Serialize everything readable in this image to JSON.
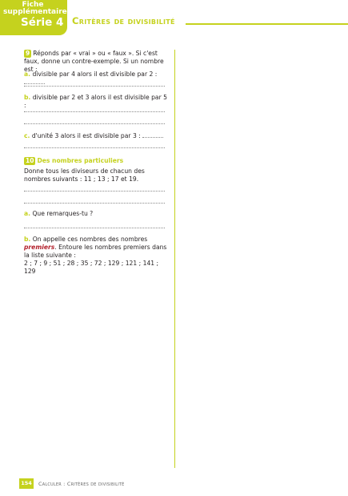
{
  "header": {
    "tab_line1": "Fiche",
    "tab_line2": "supplémentaire",
    "tab_line3": "Série 4",
    "title": "Critères de divisibilité",
    "accent_color": "#c5d21e"
  },
  "exercise9": {
    "number": "9",
    "intro": "Réponds par « vrai » ou « faux ». Si c'est faux, donne un contre-exemple. Si un nombre est :",
    "items": [
      {
        "label": "a.",
        "text": "divisible par 4 alors il est divisible par 2 :"
      },
      {
        "label": "b.",
        "text": "divisible par 2 et 3 alors il est divisible par 5 :"
      },
      {
        "label": "c.",
        "text": "d'unité 3 alors il est divisible par 3 :"
      }
    ]
  },
  "exercise10": {
    "number": "10",
    "title": "Des nombres particuliers",
    "intro": "Donne tous les diviseurs de chacun des nombres suivants : 11 ; 13 ; 17 et 19.",
    "a_label": "a.",
    "a_text": "Que remarques-tu ?",
    "b_label": "b.",
    "b_text_before": "On appelle ces nombres des nombres",
    "b_keyword": "premiers",
    "b_text_after": ". Entoure les nombres premiers dans la liste suivante :",
    "list": "2 ; 7 ; 9 ; 51 ; 28 ; 35 ; 72 ; 129 ; 121 ; 141 ; 129"
  },
  "footer": {
    "page_number": "154",
    "text": "Calculer : Critères de divisibilité"
  }
}
